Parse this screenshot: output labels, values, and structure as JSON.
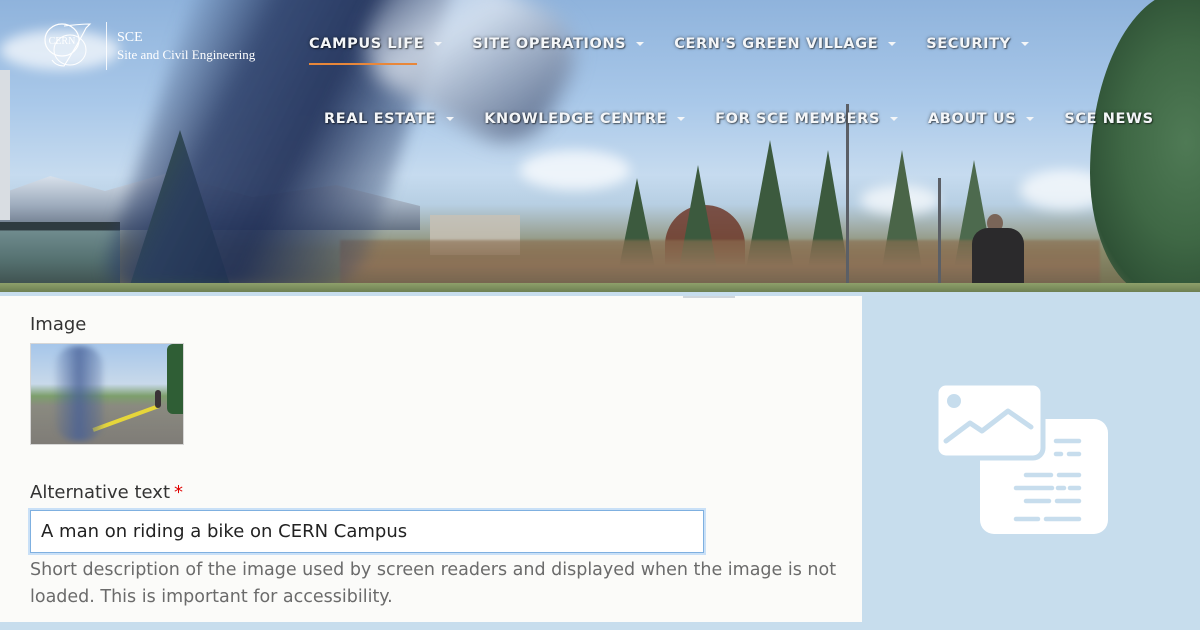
{
  "brand": {
    "logo_text": "CERN",
    "acronym": "SCE",
    "full_name": "Site and Civil Engineering"
  },
  "nav": {
    "row1": [
      {
        "label": "CAMPUS LIFE",
        "has_dropdown": true,
        "active": true
      },
      {
        "label": "SITE OPERATIONS",
        "has_dropdown": true,
        "active": false
      },
      {
        "label": "CERN'S GREEN VILLAGE",
        "has_dropdown": true,
        "active": false
      },
      {
        "label": "SECURITY",
        "has_dropdown": true,
        "active": false
      }
    ],
    "row2": [
      {
        "label": "REAL ESTATE",
        "has_dropdown": true,
        "active": false
      },
      {
        "label": "KNOWLEDGE CENTRE",
        "has_dropdown": true,
        "active": false
      },
      {
        "label": "FOR SCE MEMBERS",
        "has_dropdown": true,
        "active": false
      },
      {
        "label": "ABOUT US",
        "has_dropdown": true,
        "active": false
      },
      {
        "label": "SCE NEWS",
        "has_dropdown": false,
        "active": false
      }
    ],
    "active_underline_color": "#e8873a"
  },
  "form": {
    "image_label": "Image",
    "thumbnail_icon": "image-thumbnail",
    "alt_text_label": "Alternative text",
    "required_marker": "*",
    "alt_text_value": "A man on riding a bike on CERN Campus",
    "help_text": "Short description of the image used by screen readers and displayed when the image is not loaded. This is important for accessibility."
  },
  "illustration": {
    "icon": "image-and-document-icon"
  },
  "colors": {
    "page_background": "#c7dded",
    "panel_background": "#fbfbf9",
    "required": "#e00000",
    "input_focus_border": "#7fb0e0"
  }
}
